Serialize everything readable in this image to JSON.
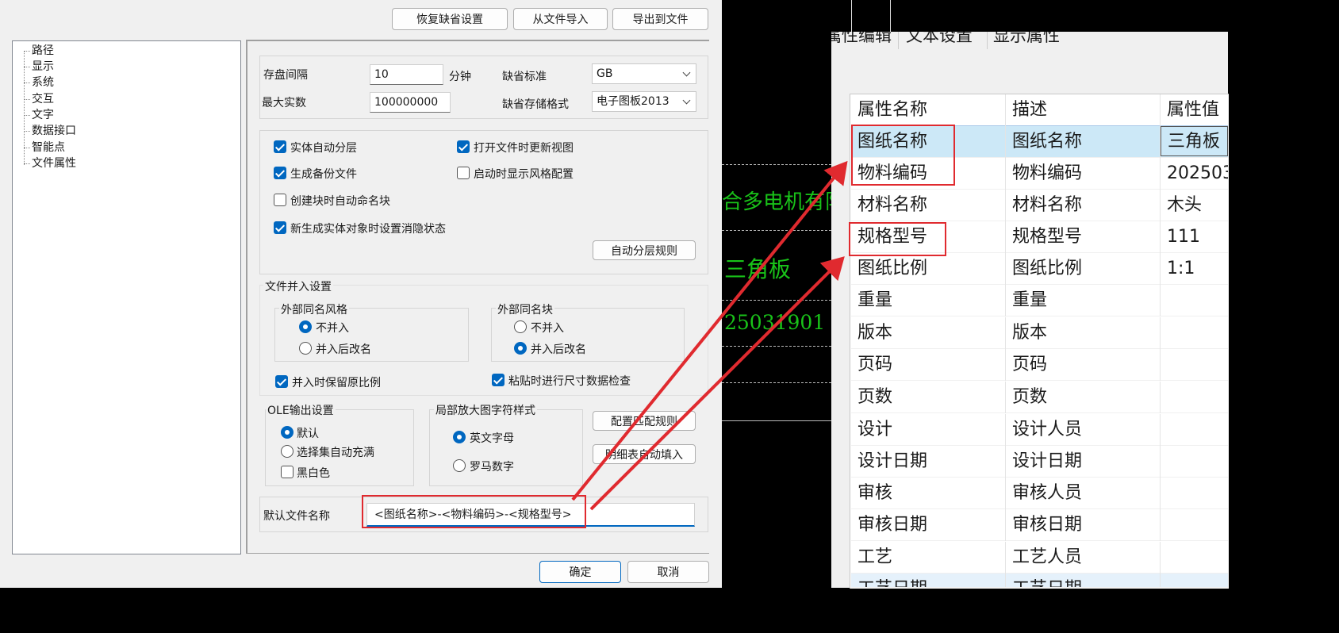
{
  "dialog": {
    "top_buttons": {
      "restore": "恢复缺省设置",
      "import": "从文件导入",
      "export": "导出到文件"
    },
    "tree": [
      "路径",
      "显示",
      "系统",
      "交互",
      "文字",
      "数据接口",
      "智能点",
      "文件属性"
    ],
    "save_interval": {
      "label": "存盘间隔",
      "value": "10",
      "unit": "分钟"
    },
    "max_count": {
      "label": "最大实数",
      "value": "100000000"
    },
    "default_standard": {
      "label": "缺省标准",
      "value": "GB"
    },
    "default_format": {
      "label": "缺省存储格式",
      "value": "电子图板2013"
    },
    "checkboxes": {
      "auto_layer": {
        "label": "实体自动分层",
        "checked": true
      },
      "refresh_view": {
        "label": "打开文件时更新视图",
        "checked": true
      },
      "backup": {
        "label": "生成备份文件",
        "checked": true
      },
      "show_style": {
        "label": "启动时显示风格配置",
        "checked": false
      },
      "auto_block_name": {
        "label": "创建块时自动命名块",
        "checked": false
      },
      "hidden_state": {
        "label": "新生成实体对象时设置消隐状态",
        "checked": true
      },
      "keep_scale": {
        "label": "并入时保留原比例",
        "checked": true
      },
      "size_check": {
        "label": "粘贴时进行尺寸数据检查",
        "checked": true
      },
      "black_white": {
        "label": "黑白色",
        "checked": false
      }
    },
    "auto_layer_rule": "自动分层规则",
    "merge_settings": {
      "title": "文件并入设置",
      "style_group": {
        "title": "外部同名风格",
        "opt1": "不并入",
        "opt2": "并入后改名",
        "selected": "不并入"
      },
      "block_group": {
        "title": "外部同名块",
        "opt1": "不并入",
        "opt2": "并入后改名",
        "selected": "并入后改名"
      }
    },
    "ole": {
      "title": "OLE输出设置",
      "opt1": "默认",
      "opt2": "选择集自动充满",
      "selected": "默认"
    },
    "zoom_style": {
      "title": "局部放大图字符样式",
      "opt1": "英文字母",
      "opt2": "罗马数字",
      "selected": "英文字母"
    },
    "config_rule": "配置匹配规则",
    "detail_fill": "明细表自动填入",
    "default_filename": {
      "label": "默认文件名称",
      "value": "<图纸名称>-<物料编码>-<规格型号>"
    },
    "ok": "确定",
    "cancel": "取消"
  },
  "drawing": {
    "company_text": "合多电机有限公",
    "part_text": "三角板",
    "code_text": "25031901"
  },
  "attr_panel": {
    "tabs": [
      "属性编辑",
      "文本设置",
      "显示属性"
    ],
    "columns": [
      "属性名称",
      "描述",
      "属性值"
    ],
    "rows": [
      {
        "name": "图纸名称",
        "desc": "图纸名称",
        "value": "三角板"
      },
      {
        "name": "物料编码",
        "desc": "物料编码",
        "value": "202503"
      },
      {
        "name": "材料名称",
        "desc": "材料名称",
        "value": "木头"
      },
      {
        "name": "规格型号",
        "desc": "规格型号",
        "value": "111"
      },
      {
        "name": "图纸比例",
        "desc": "图纸比例",
        "value": "1:1"
      },
      {
        "name": "重量",
        "desc": "重量",
        "value": ""
      },
      {
        "name": "版本",
        "desc": "版本",
        "value": ""
      },
      {
        "name": "页码",
        "desc": "页码",
        "value": ""
      },
      {
        "name": "页数",
        "desc": "页数",
        "value": ""
      },
      {
        "name": "设计",
        "desc": "设计人员",
        "value": ""
      },
      {
        "name": "设计日期",
        "desc": "设计日期",
        "value": ""
      },
      {
        "name": "审核",
        "desc": "审核人员",
        "value": ""
      },
      {
        "name": "审核日期",
        "desc": "审核日期",
        "value": ""
      },
      {
        "name": "工艺",
        "desc": "工艺人员",
        "value": ""
      },
      {
        "name": "工艺日期",
        "desc": "工艺日期",
        "value": ""
      }
    ]
  },
  "colors": {
    "accent": "#0067c0",
    "annotation": "#e02a2f",
    "cad_text": "#19c219",
    "selected_row": "#cce8f7"
  }
}
